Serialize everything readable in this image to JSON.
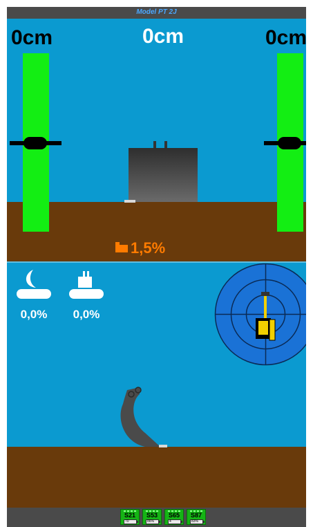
{
  "app": {
    "title": "Model PT 2J"
  },
  "readouts": {
    "left_height": "0cm",
    "center_height": "0cm",
    "right_height": "0cm"
  },
  "slope": {
    "value": "1,5%"
  },
  "sensors": [
    {
      "icon": "moon-bucket-icon",
      "value": "0,0%"
    },
    {
      "icon": "excavator-body-icon",
      "value": "0,0%"
    }
  ],
  "status_badges": [
    {
      "label": "S21",
      "battery": "70"
    },
    {
      "label": "S53",
      "battery": "86%"
    },
    {
      "label": "S65",
      "battery": "4"
    },
    {
      "label": "S87",
      "battery": "83%"
    }
  ],
  "colors": {
    "sky": "#0b9ad0",
    "ground": "#693a0b",
    "gauge": "#13ee13",
    "slope_accent": "#ff7b00",
    "bar": "#4a4a4a"
  }
}
